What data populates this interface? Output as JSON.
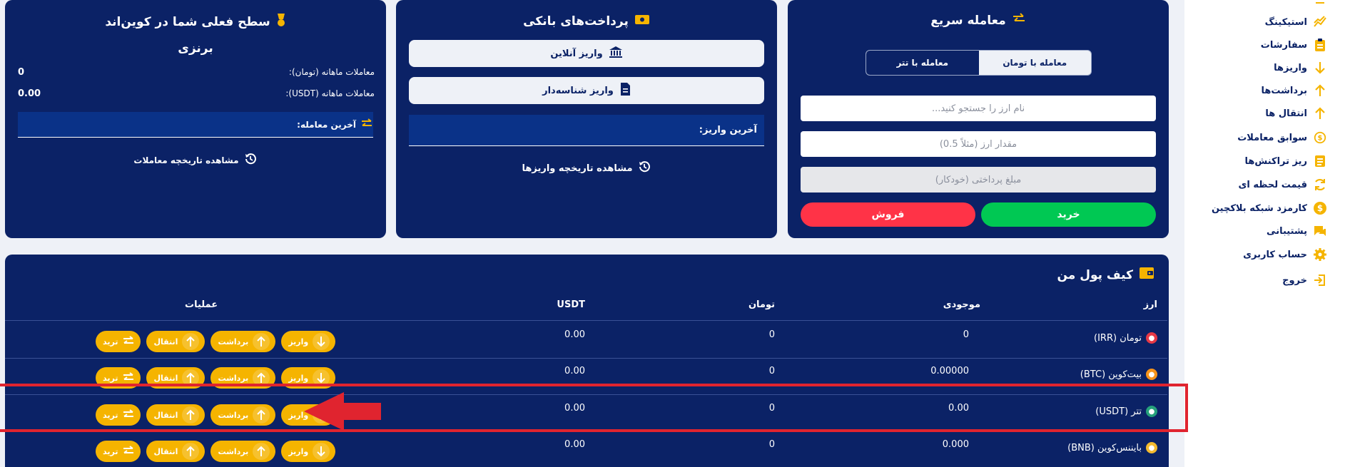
{
  "sidebar": {
    "items": [
      {
        "label": "استیکینگ",
        "icon": "chart-trend-icon"
      },
      {
        "label": "سفارشات",
        "icon": "clipboard-icon"
      },
      {
        "label": "واریزها",
        "icon": "arrow-down-icon"
      },
      {
        "label": "برداشت‌ها",
        "icon": "arrow-up-icon"
      },
      {
        "label": "انتقال ها",
        "icon": "arrow-up-icon"
      },
      {
        "label": "سوابق معاملات",
        "icon": "dollar-refresh-icon"
      },
      {
        "label": "ریز تراکنش‌ها",
        "icon": "list-icon"
      },
      {
        "label": "قیمت لحظه ای",
        "icon": "refresh-icon"
      },
      {
        "label": "کارمزد شبکه بلاکچین",
        "icon": "coin-icon"
      },
      {
        "label": "پشتیبانی",
        "icon": "chat-icon"
      },
      {
        "label": "حساب کاربری",
        "icon": "gear-icon"
      },
      {
        "label": "خروج",
        "icon": "logout-icon"
      }
    ]
  },
  "quick_trade": {
    "title": "معامله سریع",
    "tab_toman": "معامله با تومان",
    "tab_tether": "معامله با تتر",
    "search_placeholder": "نام ارز را جستجو کنید...",
    "amount_placeholder": "مقدار ارز (مثلاً 0.5)",
    "pay_placeholder": "مبلغ پرداختی (خودکار)",
    "buy_label": "خرید",
    "sell_label": "فروش"
  },
  "bank_payments": {
    "title": "پرداخت‌های بانکی",
    "online_deposit": "واریز آنلاین",
    "id_deposit": "واریز شناسه‌دار",
    "last_deposit_label": "آخرین واریز:",
    "history_link": "مشاهده تاریخچه واریزها"
  },
  "level": {
    "title": "سطح فعلی شما در کوین‌اند",
    "level_name": "برنزی",
    "monthly_toman_label": "معاملات ماهانه (تومان):",
    "monthly_toman_value": "0",
    "monthly_usdt_label": "معاملات ماهانه (USDT):",
    "monthly_usdt_value": "0.00",
    "last_trade_label": "آخرین معامله:",
    "history_link": "مشاهده تاریخچه معاملات"
  },
  "wallet": {
    "title": "کیف پول من",
    "columns": [
      "ارز",
      "موجودی",
      "تومان",
      "USDT",
      "عملیات"
    ],
    "actions": {
      "deposit": "واریز",
      "withdraw": "برداشت",
      "transfer": "انتقال",
      "trade": "ترید"
    },
    "rows": [
      {
        "name": "تومان (IRR)",
        "balance": "0",
        "toman": "0",
        "usdt": "0.00",
        "icon_color": "#e63946"
      },
      {
        "name": "بیت‌کوین (BTC)",
        "balance": "0.00000",
        "toman": "0",
        "usdt": "0.00",
        "icon_color": "#f7931a"
      },
      {
        "name": "تتر (USDT)",
        "balance": "0.00",
        "toman": "0",
        "usdt": "0.00",
        "icon_color": "#26a17b"
      },
      {
        "name": "بایننس‌کوین (BNB)",
        "balance": "0.000",
        "toman": "0",
        "usdt": "0.00",
        "icon_color": "#f3ba2f"
      }
    ]
  },
  "colors": {
    "navy": "#0b2266",
    "gold": "#f5b400",
    "buy": "#00c853",
    "sell": "#ff3347",
    "highlight": "#e0242f"
  }
}
